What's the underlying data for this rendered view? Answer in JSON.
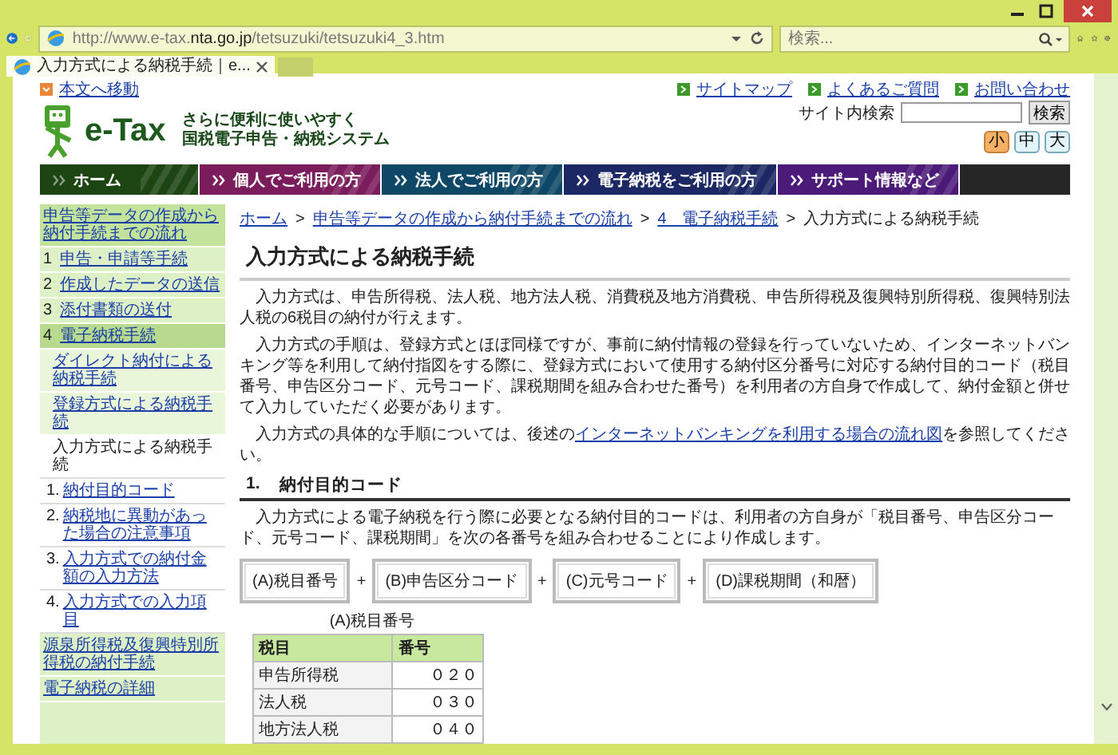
{
  "browser": {
    "address": "http://www.e-tax.**nta.go.jp**/tetsuzuki/tetsuzuki4_3.htm",
    "search": {
      "placeholder": "検索..."
    },
    "tabs": [
      {
        "label": "入力方式による納税手続｜e...",
        "selected": true
      }
    ]
  },
  "header": {
    "skip_link": "本文へ移動",
    "utility_links": [
      "サイトマップ",
      "よくあるご質問",
      "お問い合わせ"
    ],
    "logo": {
      "name": "e-Tax",
      "tagline": [
        "さらに便利に使いやすく",
        "国税電子申告・納税システム"
      ]
    },
    "site_search": {
      "label": "サイト内検索",
      "button": "検索"
    },
    "text_sizes": [
      {
        "label": "小",
        "selected": true
      },
      {
        "label": "中",
        "selected": false
      },
      {
        "label": "大",
        "selected": false
      }
    ]
  },
  "nav": [
    {
      "label": "ホーム",
      "color": "#1d4413"
    },
    {
      "label": "個人でご利用の方",
      "color": "#7b1c5c"
    },
    {
      "label": "法人でご利用の方",
      "color": "#0f4866"
    },
    {
      "label": "電子納税をご利用の方",
      "color": "#1b2863"
    },
    {
      "label": "サポート情報など",
      "color": "#4c1a78"
    }
  ],
  "sidebar": {
    "heading": "申告等データの作成から納付手続までの流れ",
    "items": [
      {
        "number": "1",
        "label": "申告・申請等手続",
        "expanded": false
      },
      {
        "number": "2",
        "label": "作成したデータの送信",
        "expanded": false
      },
      {
        "number": "3",
        "label": "添付書類の送付",
        "expanded": false
      },
      {
        "number": "4",
        "label": "電子納税手続",
        "expanded": true,
        "children": [
          {
            "label": "ダイレクト納付による納税手続",
            "selected": false
          },
          {
            "label": "登録方式による納税手続",
            "selected": false
          },
          {
            "label": "入力方式による納税手続",
            "selected": true,
            "children": [
              {
                "number": "1.",
                "label": "納付目的コード"
              },
              {
                "number": "2.",
                "label": "納税地に異動があった場合の注意事項"
              },
              {
                "number": "3.",
                "label": "入力方式での納付金額の入力方法"
              },
              {
                "number": "4.",
                "label": "入力方式での入力項目"
              }
            ]
          }
        ]
      },
      {
        "label": "源泉所得税及復興特別所得税の納付手続",
        "expanded": false
      },
      {
        "label": "電子納税の詳細",
        "expanded": false
      }
    ]
  },
  "main": {
    "breadcrumb": [
      {
        "kind": "link",
        "text": "ホーム"
      },
      {
        "kind": "sep",
        "text": ">"
      },
      {
        "kind": "link",
        "text": "申告等データの作成から納付手続までの流れ"
      },
      {
        "kind": "sep",
        "text": ">"
      },
      {
        "kind": "link",
        "text": "4　電子納税手続"
      },
      {
        "kind": "sep",
        "text": ">"
      },
      {
        "kind": "current",
        "text": "入力方式による納税手続"
      }
    ],
    "title": "入力方式による納税手続",
    "paragraphs": [
      {
        "text": "入力方式は、申告所得税、法人税、地方法人税、消費税及地方消費税、申告所得税及復興特別所得税、復興特別法人税の6税目の納付が行えます。"
      },
      {
        "text": "入力方式の手順は、登録方式とほぼ同様ですが、事前に納付情報の登録を行っていないため、インターネットバンキング等を利用して納付指図をする際に、登録方式において使用する納付区分番号に対応する納付目的コード（税目番号、申告区分コード、元号コード、課税期間を組み合わせた番号）を利用者の方自身で作成して、納付金額と併せて入力していただく必要があります。"
      },
      {
        "text": "入力方式の具体的な手順については、後述の",
        "link": "インターネットバンキングを利用する場合の流れ図",
        "after": "を参照してください。"
      }
    ],
    "section": {
      "number": "1.",
      "title": "納付目的コード",
      "text": "入力方式による電子納税を行う際に必要となる納付目的コードは、利用者の方自身が「税目番号、申告区分コード、元号コード、課税期間」を次の各番号を組み合わせることにより作成します。",
      "formula": [
        {
          "kind": "box",
          "text": "(A)税目番号"
        },
        {
          "kind": "plus",
          "text": "+"
        },
        {
          "kind": "box",
          "text": "(B)申告区分コード"
        },
        {
          "kind": "plus",
          "text": "+"
        },
        {
          "kind": "box",
          "text": "(C)元号コード"
        },
        {
          "kind": "plus",
          "text": "+"
        },
        {
          "kind": "box",
          "text": "(D)課税期間（和暦）"
        }
      ],
      "table": {
        "caption": "(A)税目番号",
        "columns": [
          "税目",
          "番号"
        ],
        "rows": [
          [
            "申告所得税",
            "０２０"
          ],
          [
            "法人税",
            "０３０"
          ],
          [
            "地方法人税",
            "０４０"
          ]
        ]
      }
    }
  }
}
